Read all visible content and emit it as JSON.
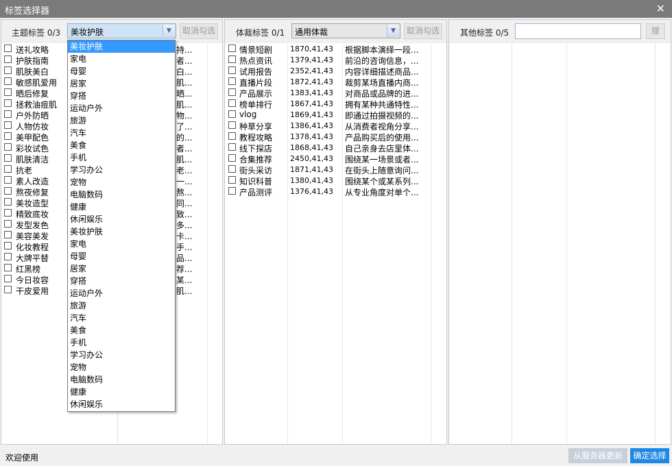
{
  "window": {
    "title": "标签选择器",
    "close_glyph": "✕"
  },
  "topic_panel": {
    "label": "主题标签",
    "count": "0/3",
    "selected": "美妆护肤",
    "clear_button": "取消勾选",
    "items": [
      {
        "name": "送礼攻略",
        "desc": "持..."
      },
      {
        "name": "护肤指南",
        "desc": "者..."
      },
      {
        "name": "肌肤美白",
        "desc": "白..."
      },
      {
        "name": "敏感肌爱用",
        "desc": "肌..."
      },
      {
        "name": "晒后修复",
        "desc": "晒..."
      },
      {
        "name": "拯救油痘肌",
        "desc": "肌..."
      },
      {
        "name": "户外防晒",
        "desc": "物..."
      },
      {
        "name": "人物仿妆",
        "desc": "了..."
      },
      {
        "name": "美甲配色",
        "desc": "的..."
      },
      {
        "name": "彩妆试色",
        "desc": "者..."
      },
      {
        "name": "肌肤清洁",
        "desc": "肌..."
      },
      {
        "name": "抗老",
        "desc": "老..."
      },
      {
        "name": "素人改造",
        "desc": "一..."
      },
      {
        "name": "熬夜修复",
        "desc": "熬..."
      },
      {
        "name": "美妆造型",
        "desc": "同..."
      },
      {
        "name": "精致底妆",
        "desc": "致..."
      },
      {
        "name": "发型发色",
        "desc": "多..."
      },
      {
        "name": "美容美发",
        "desc": "卡..."
      },
      {
        "name": "化妆教程",
        "desc": "手..."
      },
      {
        "name": "大牌平替",
        "desc": "品..."
      },
      {
        "name": "红黑榜",
        "desc": "荐..."
      },
      {
        "name": "今日妆容",
        "desc": "某..."
      },
      {
        "name": "干皮爱用",
        "desc": "肌..."
      }
    ]
  },
  "dropdown": {
    "options": [
      "美妆护肤",
      "家电",
      "母婴",
      "居家",
      "穿搭",
      "运动户外",
      "旅游",
      "汽车",
      "美食",
      "手机",
      "学习办公",
      "宠物",
      "电脑数码",
      "健康",
      "休闲娱乐",
      "美妆护肤",
      "家电",
      "母婴",
      "居家",
      "穿搭",
      "运动户外",
      "旅游",
      "汽车",
      "美食",
      "手机",
      "学习办公",
      "宠物",
      "电脑数码",
      "健康",
      "休闲娱乐"
    ],
    "selected_index": 0
  },
  "genre_panel": {
    "label": "体裁标签",
    "count": "0/1",
    "selected": "通用体裁",
    "clear_button": "取消勾选",
    "items": [
      {
        "name": "情景短剧",
        "code": "1870,41,43",
        "desc": "根据脚本演绎一段..."
      },
      {
        "name": "热点资讯",
        "code": "1379,41,43",
        "desc": "前沿的咨询信息，..."
      },
      {
        "name": "试用报告",
        "code": "2352,41,43",
        "desc": "内容详细描述商品..."
      },
      {
        "name": "直播片段",
        "code": "1872,41,43",
        "desc": "裁剪某场直播内商..."
      },
      {
        "name": "产品展示",
        "code": "1383,41,43",
        "desc": "对商品或品牌的进..."
      },
      {
        "name": "榜单排行",
        "code": "1867,41,43",
        "desc": "拥有某种共通特性..."
      },
      {
        "name": "vlog",
        "code": "1869,41,43",
        "desc": "即通过拍摄视频的..."
      },
      {
        "name": "种草分享",
        "code": "1386,41,43",
        "desc": "从消费者视角分享..."
      },
      {
        "name": "教程攻略",
        "code": "1378,41,43",
        "desc": "产品购买后的使用..."
      },
      {
        "name": "线下探店",
        "code": "1868,41,43",
        "desc": "自己亲身去店里体..."
      },
      {
        "name": "合集推荐",
        "code": "2450,41,43",
        "desc": "围绕某一场景或者..."
      },
      {
        "name": "街头采访",
        "code": "1871,41,43",
        "desc": "在街头上随意询问..."
      },
      {
        "name": "知识科普",
        "code": "1380,41,43",
        "desc": "围绕某个或某系列..."
      },
      {
        "name": "产品测评",
        "code": "1376,41,43",
        "desc": "从专业角度对单个..."
      }
    ]
  },
  "other_panel": {
    "label": "其他标签",
    "count": "0/5",
    "search_value": "",
    "search_button": "搜"
  },
  "status": {
    "text": "欢迎使用",
    "refresh_button": "从服务器更新",
    "confirm_button": "确定选择"
  },
  "colors": {
    "accent": "#1e88e5",
    "dropdown_highlight": "#3399ff",
    "titlebar": "#7a7a7a"
  }
}
